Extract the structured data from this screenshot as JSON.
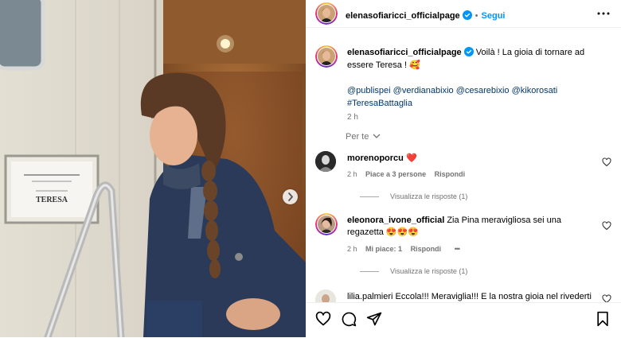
{
  "header": {
    "username": "elenasofiaricci_officialpage",
    "separator": "•",
    "follow_label": "Segui",
    "more_icon": "more-horizontal-icon"
  },
  "post": {
    "caption_user": "elenasofiaricci_officialpage",
    "caption_text": "Voilà ! La gioia di tornare ad essere Teresa ! 🥰",
    "mentions": [
      "@publispei",
      "@verdianabixio",
      "@cesarebixio",
      "@kikorosati",
      "#TeresaBattaglia"
    ],
    "time": "2 h",
    "sign_text": "TERESA",
    "carousel_next_icon": "chevron-right-icon"
  },
  "comments_filter": {
    "label": "Per te"
  },
  "comments": [
    {
      "user": "morenoporcu",
      "text": "❤️",
      "time": "2 h",
      "likes": "Piace a 3 persone",
      "reply": "Rispondi",
      "view_replies": "Visualizza le risposte (1)"
    },
    {
      "user": "eleonora_ivone_official",
      "text": "Zia Pina meravigliosa sei una regazetta 😍😍😍",
      "time": "2 h",
      "likes": "Mi piace: 1",
      "reply": "Rispondi",
      "more": "•••",
      "view_replies": "Visualizza le risposte (1)"
    },
    {
      "user": "lilia.palmieri",
      "text": "Eccola!!! Meraviglia!!! E la nostra gioia nel rivederti"
    }
  ],
  "actions": {
    "like_icon": "heart-icon",
    "comment_icon": "comment-icon",
    "share_icon": "send-icon",
    "save_icon": "bookmark-icon"
  },
  "colors": {
    "link": "#0095f6",
    "mention": "#00376b",
    "meta": "#737373",
    "heart_red": "#ed4956"
  }
}
